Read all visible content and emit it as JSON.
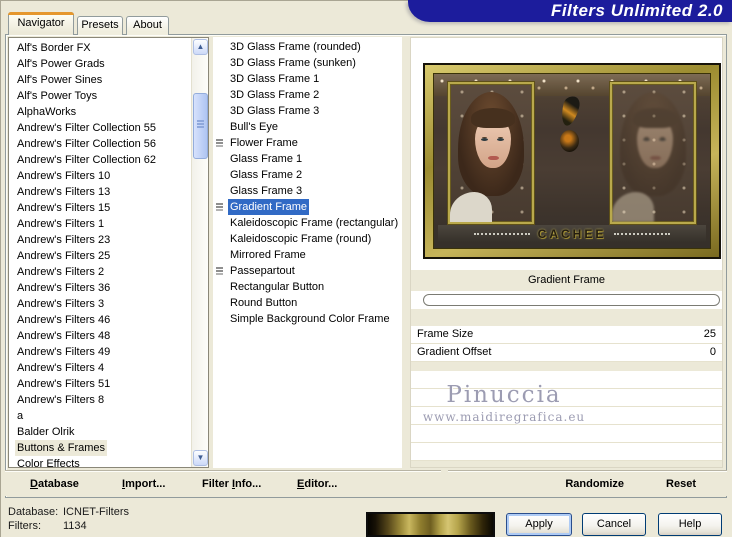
{
  "title_banner": {
    "text": "Filters Unlimited 2.0"
  },
  "tabs": {
    "navigator": "Navigator",
    "presets": "Presets",
    "about": "About",
    "active": "Navigator"
  },
  "category_list": {
    "selected": "Buttons & Frames",
    "items": [
      "Alf's Border FX",
      "Alf's Power Grads",
      "Alf's Power Sines",
      "Alf's Power Toys",
      "AlphaWorks",
      "Andrew's Filter Collection 55",
      "Andrew's Filter Collection 56",
      "Andrew's Filter Collection 62",
      "Andrew's Filters 10",
      "Andrew's Filters 13",
      "Andrew's Filters 15",
      "Andrew's Filters 1",
      "Andrew's Filters 23",
      "Andrew's Filters 25",
      "Andrew's Filters 2",
      "Andrew's Filters 36",
      "Andrew's Filters 3",
      "Andrew's Filters 46",
      "Andrew's Filters 48",
      "Andrew's Filters 49",
      "Andrew's Filters 4",
      "Andrew's Filters 51",
      "Andrew's Filters 8",
      "a",
      "Balder Olrik",
      "Buttons & Frames",
      "Color Effects"
    ]
  },
  "filter_list": {
    "selected": "Gradient Frame",
    "marked": [
      "Flower Frame",
      "Gradient Frame",
      "Passepartout"
    ],
    "items": [
      "3D Glass Frame (rounded)",
      "3D Glass Frame (sunken)",
      "3D Glass Frame 1",
      "3D Glass Frame 2",
      "3D Glass Frame 3",
      "Bull's Eye",
      "Flower Frame",
      "Glass Frame 1",
      "Glass Frame 2",
      "Glass Frame 3",
      "Gradient Frame",
      "Kaleidoscopic Frame (rectangular)",
      "Kaleidoscopic Frame (round)",
      "Mirrored Frame",
      "Passepartout",
      "Rectangular Button",
      "Round Button",
      "Simple Background Color Frame"
    ]
  },
  "preview": {
    "caption": "CACHEE"
  },
  "panel": {
    "filter_title": "Gradient Frame",
    "params": [
      {
        "name": "Frame Size",
        "value": "25"
      },
      {
        "name": "Gradient Offset",
        "value": "0"
      }
    ],
    "blank_rows": 5
  },
  "watermark": {
    "line1": "Pinuccia",
    "line2": "www.maidiregrafica.eu"
  },
  "menu": {
    "database": "Database",
    "import": "Import...",
    "filter_info": "Filter Info...",
    "editor": "Editor...",
    "randomize": "Randomize",
    "reset": "Reset"
  },
  "buttons": {
    "apply": "Apply",
    "cancel": "Cancel",
    "help": "Help"
  },
  "status": {
    "database_label": "Database:",
    "database_value": "ICNET-Filters",
    "filters_label": "Filters:",
    "filters_value": "1134"
  },
  "colors": {
    "selection": "#316AC5",
    "banner": "#1C1C9C",
    "background": "#ECE9D8",
    "gold": "#B3A144"
  }
}
